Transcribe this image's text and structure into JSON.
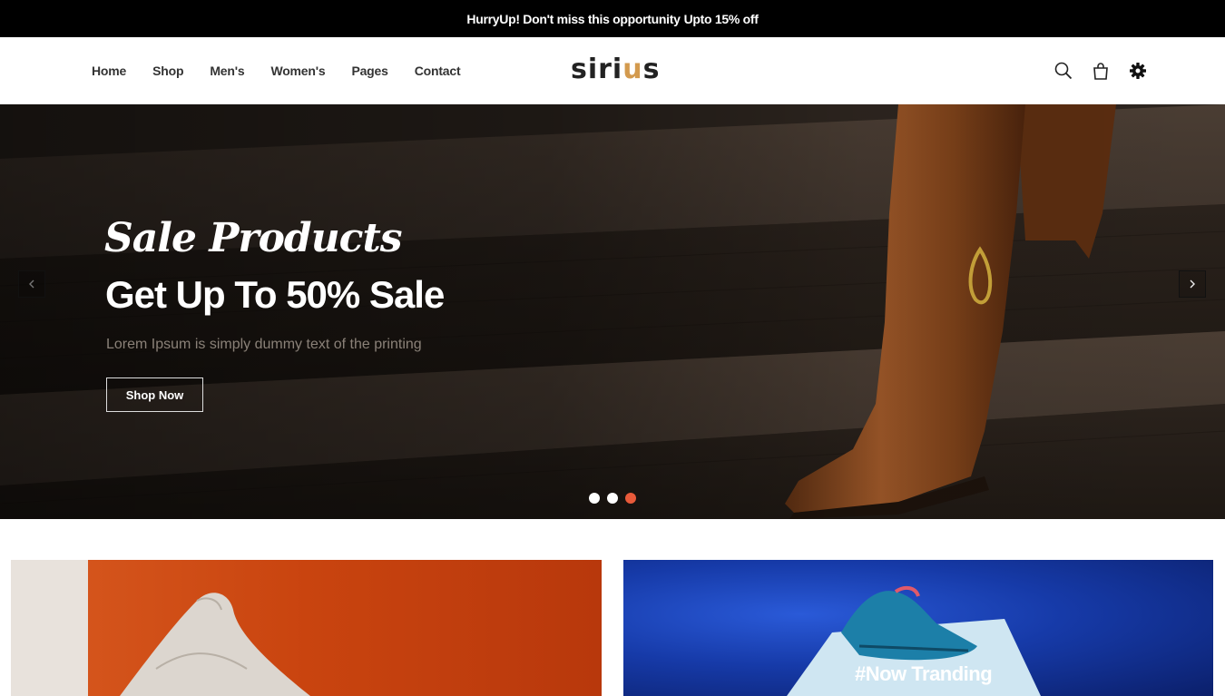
{
  "topbar": {
    "promo_text": "HurryUp! Don't miss this opportunity",
    "promo_strong": "Upto 15% off"
  },
  "nav": {
    "items": [
      "Home",
      "Shop",
      "Men's",
      "Women's",
      "Pages",
      "Contact"
    ]
  },
  "logo": {
    "part1": "siri",
    "accent": "u",
    "part2": "s",
    "accent_color": "#d39a4e"
  },
  "header_icons": [
    "search-icon",
    "shopping-bag-icon",
    "gear-icon"
  ],
  "hero": {
    "script_title": "Sale Products",
    "title": "Get Up To 50% Sale",
    "subtitle": "Lorem Ipsum is simply dummy text of the printing",
    "button_label": "Shop Now",
    "slides": 3,
    "active_slide": 3,
    "active_dot_color": "#e85a3a"
  },
  "cards": {
    "right_label": "#Now Tranding"
  }
}
